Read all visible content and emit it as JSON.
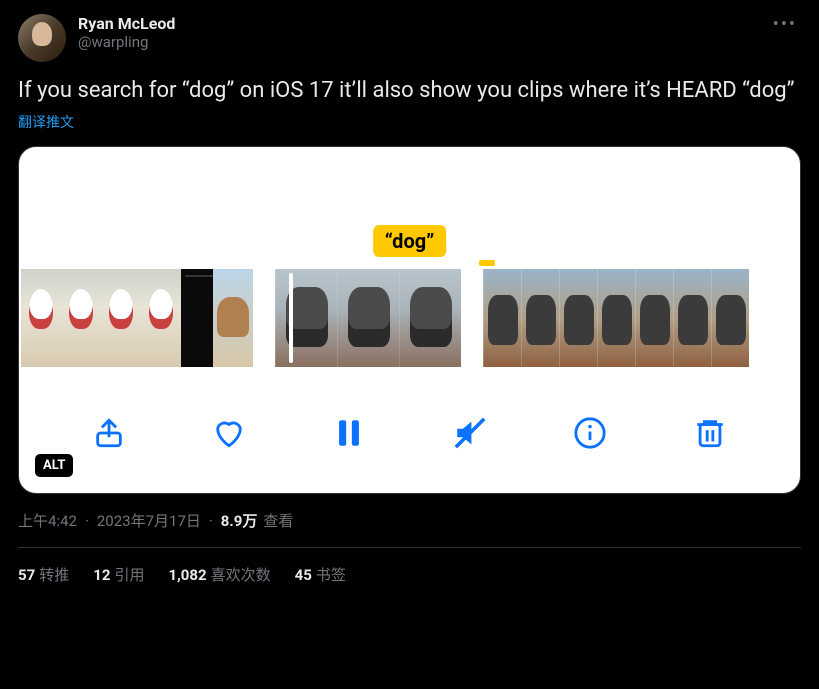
{
  "tweet": {
    "author": {
      "display_name": "Ryan McLeod",
      "handle": "@warpling"
    },
    "body": "If you search for “dog” on iOS 17 it’ll also show you clips where it’s HEARD “dog”",
    "translate_label": "翻译推文",
    "media": {
      "caption_label": "“dog”",
      "alt_badge": "ALT"
    },
    "meta": {
      "time": "上午4:42",
      "date": "2023年7月17日",
      "views_count": "8.9万",
      "views_label": "查看"
    },
    "stats": {
      "retweets": {
        "count": "57",
        "label": "转推"
      },
      "quotes": {
        "count": "12",
        "label": "引用"
      },
      "likes": {
        "count": "1,082",
        "label": "喜欢次数"
      },
      "bookmarks": {
        "count": "45",
        "label": "书签"
      }
    }
  }
}
